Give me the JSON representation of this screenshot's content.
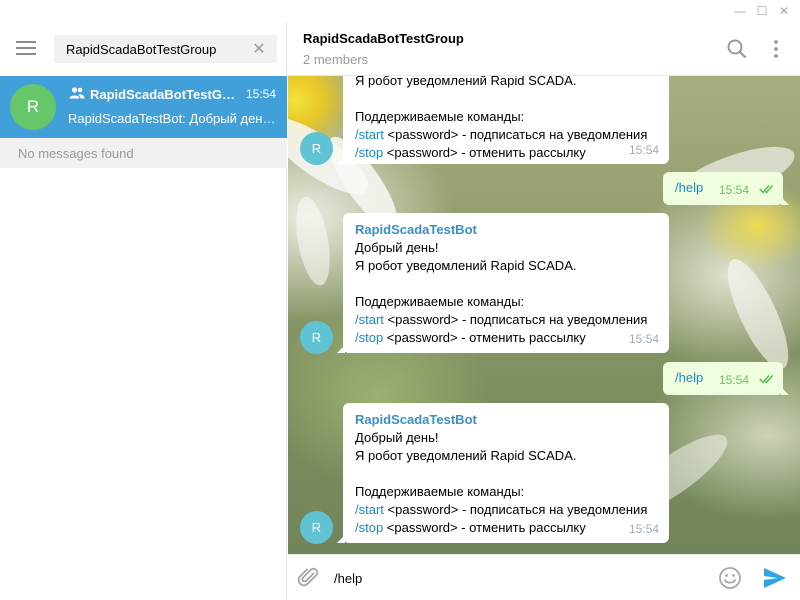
{
  "window": {
    "minimize_glyph": "—",
    "maximize_glyph": "☐",
    "close_glyph": "✕"
  },
  "sidebar": {
    "search": {
      "value": "RapidScadaBotTestGroup",
      "clear_glyph": "✕"
    },
    "chat": {
      "avatar_letter": "R",
      "title": "RapidScadaBotTestGroup",
      "time": "15:54",
      "preview": "RapidScadaTestBot: Добрый день! Я робот уведомлений Rapid SCADA.",
      "avatar_color": "#65c76a",
      "selected_color": "#419fd9"
    },
    "no_messages": "No messages found"
  },
  "header": {
    "title": "RapidScadaBotTestGroup",
    "subtitle": "2 members"
  },
  "messages": {
    "msg1": {
      "line_partial": "Я робот уведомлений Rapid SCADA.",
      "commands_header": "Поддерживаемые команды:",
      "start_cmd": "/start",
      "start_desc": " <password> - подписаться на уведомления",
      "stop_cmd": "/stop",
      "stop_desc": " <password> - отменить рассылку",
      "time": "15:54",
      "avatar_letter": "R"
    },
    "out1": {
      "text": "/help",
      "time": "15:54"
    },
    "msg2": {
      "sender": "RapidScadaTestBot",
      "greeting": "Добрый день!",
      "intro": "Я робот уведомлений Rapid SCADA.",
      "commands_header": "Поддерживаемые команды:",
      "start_cmd": "/start",
      "start_desc": " <password> - подписаться на уведомления",
      "stop_cmd": "/stop",
      "stop_desc": " <password> - отменить рассылку",
      "time": "15:54",
      "avatar_letter": "R"
    },
    "out2": {
      "text": "/help",
      "time": "15:54"
    },
    "msg3": {
      "sender": "RapidScadaTestBot",
      "greeting": "Добрый день!",
      "intro": "Я робот уведомлений Rapid SCADA.",
      "commands_header": "Поддерживаемые команды:",
      "start_cmd": "/start",
      "start_desc": " <password> - подписаться на уведомления",
      "stop_cmd": "/stop",
      "stop_desc": " <password> - отменить рассылку",
      "time": "15:54",
      "avatar_letter": "R"
    }
  },
  "composer": {
    "value": "/help",
    "attach_icon": "paperclip-icon",
    "emoji_icon": "smile-icon",
    "send_icon": "send-icon",
    "send_color": "#2ea6e6"
  },
  "colors": {
    "link": "#168acd",
    "sender": "#3a8fc4",
    "outgoing_bubble": "#effdde",
    "check": "#5fbf5a"
  }
}
